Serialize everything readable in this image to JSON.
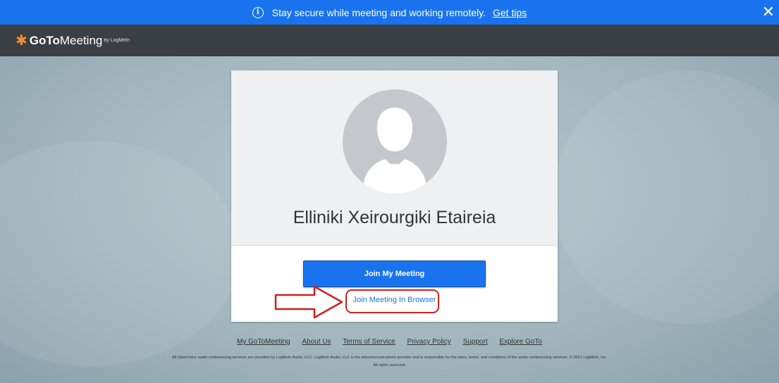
{
  "banner": {
    "message": "Stay secure while meeting and working remotely.",
    "link": "Get tips",
    "close": "✕"
  },
  "logo": {
    "goto": "GoTo",
    "meeting": "Meeting",
    "by": "by LogMeIn"
  },
  "card": {
    "name": "Elliniki Xeirourgiki Etaireia",
    "join_button": "Join My Meeting",
    "browser_link": "Join Meeting In Browser"
  },
  "footer": {
    "links": [
      "My GoToMeeting",
      "About Us",
      "Terms of Service",
      "Privacy Policy",
      "Support",
      "Explore GoTo"
    ],
    "disclaimer": "All OpenVoice audio conferencing services are provided by LogMeIn Audio, LLC. LogMeIn Audio, LLC is the telecommunications provider and is responsible for the rates, terms, and conditions of the audio conferencing services. © 2021 LogMeIn, Inc.",
    "rights": "All rights reserved."
  },
  "colors": {
    "accent": "#1a73ee",
    "annotation": "#d11f1f",
    "brand_orange": "#f68d2e"
  }
}
